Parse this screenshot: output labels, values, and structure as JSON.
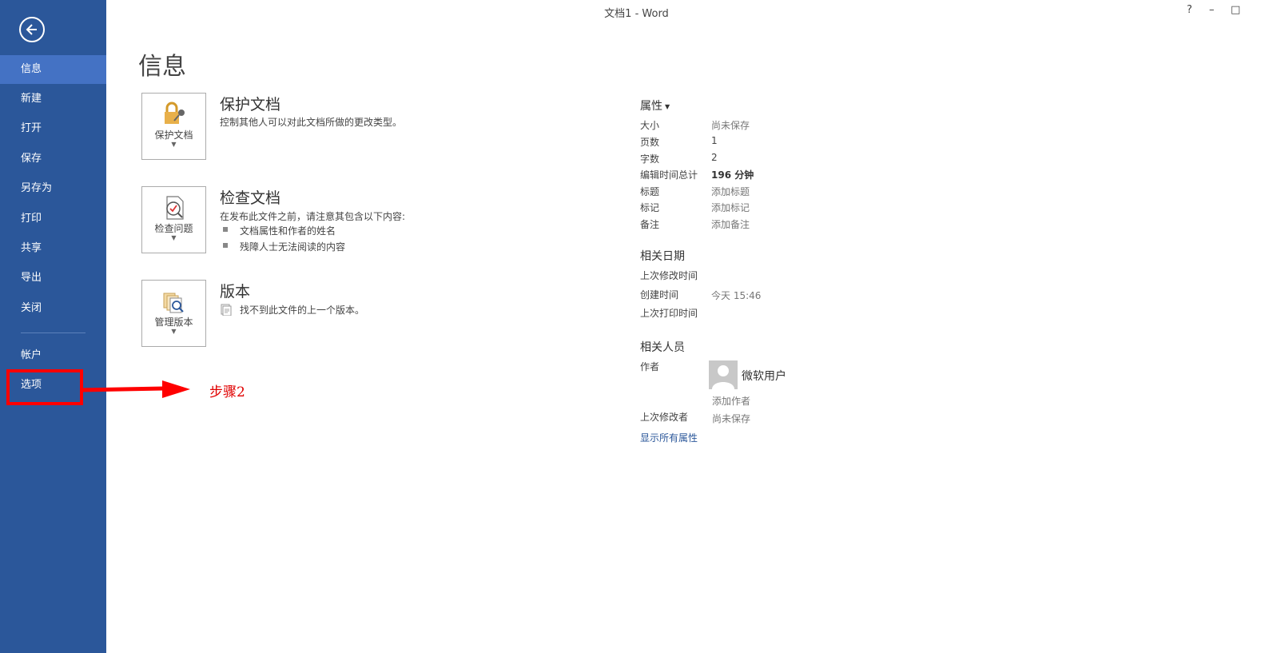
{
  "window": {
    "title": "文档1 - Word",
    "help": "?",
    "minimize": "–",
    "restore": "□"
  },
  "nav": {
    "items": [
      "信息",
      "新建",
      "打开",
      "保存",
      "另存为",
      "打印",
      "共享",
      "导出",
      "关闭"
    ],
    "account": "帐户",
    "options": "选项"
  },
  "page": {
    "title": "信息"
  },
  "protect": {
    "button_label": "保护文档",
    "title": "保护文档",
    "description": "控制其他人可以对此文档所做的更改类型。"
  },
  "inspect": {
    "button_label": "检查问题",
    "title": "检查文档",
    "description": "在发布此文件之前，请注意其包含以下内容:",
    "bullets": [
      "文档属性和作者的姓名",
      "残障人士无法阅读的内容"
    ]
  },
  "versions": {
    "button_label": "管理版本",
    "title": "版本",
    "description": "找不到此文件的上一个版本。"
  },
  "properties": {
    "heading": "属性",
    "rows": [
      {
        "label": "大小",
        "value": "尚未保存"
      },
      {
        "label": "页数",
        "value": "1"
      },
      {
        "label": "字数",
        "value": "2"
      },
      {
        "label": "编辑时间总计",
        "value": "196 分钟"
      },
      {
        "label": "标题",
        "value": "添加标题"
      },
      {
        "label": "标记",
        "value": "添加标记"
      },
      {
        "label": "备注",
        "value": "添加备注"
      }
    ]
  },
  "dates": {
    "heading": "相关日期",
    "last_modified_label": "上次修改时间",
    "created_label": "创建时间",
    "created_value": "今天 15:46",
    "last_printed_label": "上次打印时间"
  },
  "people": {
    "heading": "相关人员",
    "author_label": "作者",
    "author_name": "微软用户",
    "add_author": "添加作者",
    "last_modified_by_label": "上次修改者",
    "last_modified_by_value": "尚未保存",
    "show_all": "显示所有属性"
  },
  "annotation": {
    "step_label": "步骤2",
    "color": "#ff0000"
  },
  "colors": {
    "sidebar": "#2b579a",
    "sidebar_active": "#4472c4"
  }
}
